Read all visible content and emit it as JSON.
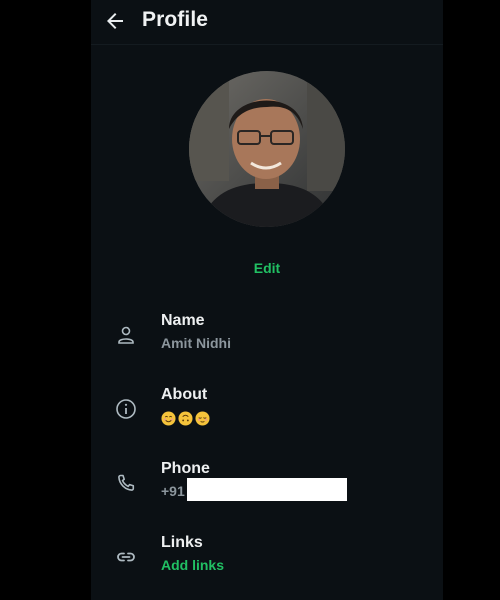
{
  "header": {
    "title": "Profile",
    "back_icon": "arrow-left-icon"
  },
  "profile": {
    "edit_label": "Edit"
  },
  "fields": {
    "name": {
      "label": "Name",
      "value": "Amit Nidhi",
      "icon": "person-icon"
    },
    "about": {
      "label": "About",
      "value": "😊🙃☺️",
      "icon": "info-icon"
    },
    "phone": {
      "label": "Phone",
      "value": "+91",
      "icon": "phone-icon"
    },
    "links": {
      "label": "Links",
      "value": "Add links",
      "icon": "link-icon"
    }
  },
  "colors": {
    "background": "#0b1014",
    "accent": "#21c063",
    "secondary_text": "#8c969d",
    "primary_text": "#e9edef"
  }
}
